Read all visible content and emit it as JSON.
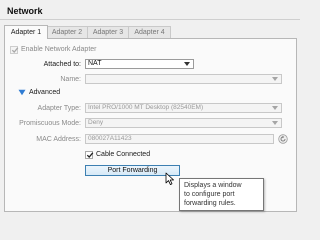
{
  "section_title": "Network",
  "tabs": [
    {
      "label": "Adapter 1",
      "active": true
    },
    {
      "label": "Adapter 2",
      "active": false
    },
    {
      "label": "Adapter 3",
      "active": false
    },
    {
      "label": "Adapter 4",
      "active": false
    }
  ],
  "enable_adapter": {
    "label": "Enable Network Adapter",
    "checked": true,
    "enabled": false
  },
  "attached_to": {
    "label": "Attached to:",
    "value": "NAT"
  },
  "name": {
    "label": "Name:",
    "value": ""
  },
  "advanced": {
    "label": "Advanced",
    "icon": "expand-triangle-icon"
  },
  "adapter_type": {
    "label": "Adapter Type:",
    "value": "Intel PRO/1000 MT Desktop (82540EM)"
  },
  "promiscuous_mode": {
    "label": "Promiscuous Mode:",
    "value": "Deny"
  },
  "mac_address": {
    "label": "MAC Address:",
    "value": "080027A11423",
    "icon": "refresh-icon"
  },
  "cable_connected": {
    "label": "Cable Connected",
    "checked": true
  },
  "port_forwarding": {
    "label": "Port Forwarding"
  },
  "tooltip": {
    "lines": [
      "Displays a window",
      "to configure port",
      "forwarding rules."
    ]
  },
  "colors": {
    "accent": "#3c7fb1",
    "link": "#1e64b4"
  }
}
